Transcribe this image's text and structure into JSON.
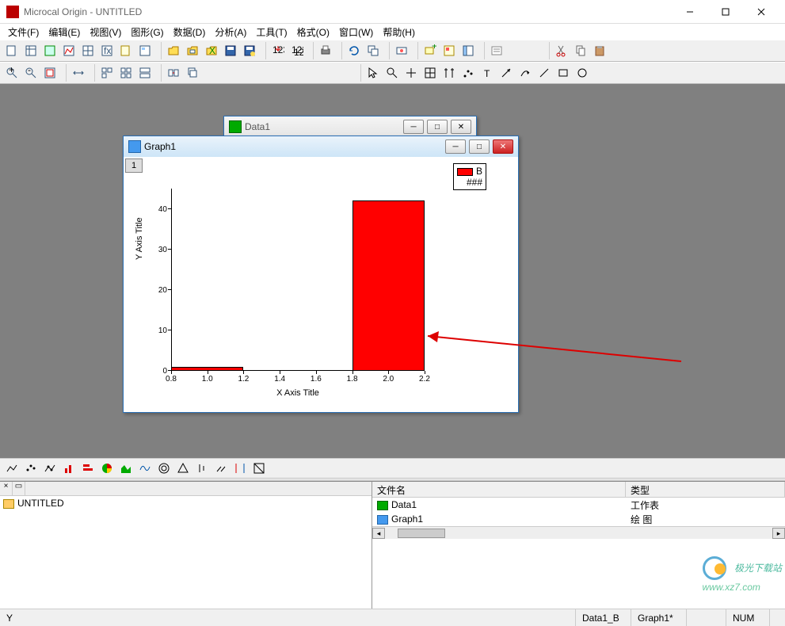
{
  "app": {
    "title": "Microcal Origin - UNTITLED"
  },
  "menu": [
    "文件(F)",
    "编辑(E)",
    "视图(V)",
    "图形(G)",
    "数据(D)",
    "分析(A)",
    "工具(T)",
    "格式(O)",
    "窗口(W)",
    "帮助(H)"
  ],
  "child_windows": {
    "data1": {
      "title": "Data1"
    },
    "graph1": {
      "title": "Graph1",
      "layer": "1"
    }
  },
  "chart_data": {
    "type": "bar",
    "x": [
      1.0,
      2.0
    ],
    "values": [
      1,
      42
    ],
    "xlabel": "X Axis Title",
    "ylabel": "Y Axis Title",
    "xticks": [
      0.8,
      1.0,
      1.2,
      1.4,
      1.6,
      1.8,
      2.0,
      2.2
    ],
    "yticks": [
      0,
      10,
      20,
      30,
      40
    ],
    "xlim": [
      0.8,
      2.2
    ],
    "ylim": [
      0,
      45
    ],
    "legend": {
      "label": "B",
      "sub": "###"
    },
    "color": "#ff0000"
  },
  "tree": {
    "root": "UNTITLED"
  },
  "list": {
    "cols": {
      "name": "文件名",
      "type": "类型"
    },
    "rows": [
      {
        "name": "Data1",
        "type": "工作表",
        "kind": "ws"
      },
      {
        "name": "Graph1",
        "type": "绘 图",
        "kind": "gr"
      }
    ]
  },
  "status": {
    "left": "Y",
    "s1": "Data1_B",
    "s2": "Graph1*",
    "s3": "",
    "num": "NUM"
  },
  "watermark": {
    "t1": "极光下载站",
    "t2": "www.xz7.com"
  }
}
